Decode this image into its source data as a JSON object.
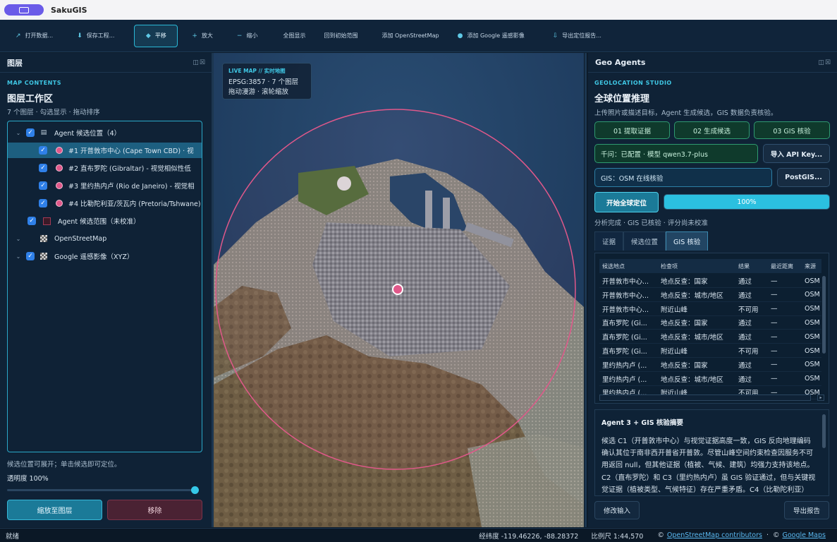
{
  "app": {
    "title": "SakuGIS"
  },
  "toolbar": {
    "items": [
      {
        "icon": "↗",
        "label": "打开数据..."
      },
      {
        "icon": "⬇",
        "label": "保存工程..."
      },
      {
        "icon": "◆",
        "label": "平移"
      },
      {
        "icon": "+",
        "label": "放大"
      },
      {
        "icon": "−",
        "label": "缩小"
      },
      {
        "icon": "",
        "label": "全图显示"
      },
      {
        "icon": "",
        "label": "回到初始范围"
      },
      {
        "icon": "",
        "label": "添加 OpenStreetMap"
      },
      {
        "icon": "●",
        "label": "添加 Google 遥感影像"
      },
      {
        "icon": "⇩",
        "label": "导出定位报告..."
      }
    ],
    "active_index": 2
  },
  "layers_panel": {
    "title": "图层",
    "kicker": "MAP CONTENTS",
    "heading": "图层工作区",
    "subtitle": "7 个图层 · 勾选显示 · 拖动排序",
    "rows": [
      {
        "label": "Agent 候选位置（4）"
      },
      {
        "label": "#1 开普敦市中心 (Cape Town CBD) · 视"
      },
      {
        "label": "#2 直布罗陀 (Gibraltar) - 视觉相似性低"
      },
      {
        "label": "#3 里约热内卢 (Rio de Janeiro) - 视觉相"
      },
      {
        "label": "#4 比勒陀利亚/茨瓦内 (Pretoria/Tshwane)"
      },
      {
        "label": "Agent 候选范围（未校准）"
      },
      {
        "label": "OpenStreetMap"
      },
      {
        "label": "Google 遥感影像（XYZ）"
      }
    ],
    "hint": "候选位置可展开；单击候选即可定位。",
    "opacity_label": "透明度 100%",
    "opacity_value": 1.0,
    "zoom_button": "缩放至图层",
    "remove_button": "移除"
  },
  "map": {
    "badge_kicker": "LIVE MAP // 实时地图",
    "badge_line1": "EPSG:3857 · 7 个图层",
    "badge_line2": "拖动漫游 · 滚轮缩放"
  },
  "agents_panel": {
    "title": "Geo Agents",
    "kicker": "GEOLOCATION STUDIO",
    "heading": "全球位置推理",
    "subtitle": "上传照片或描述目标，Agent 生成候选，GIS 数据负责核验。",
    "steps": [
      "01 提取证据",
      "02 生成候选",
      "03 GIS 核验"
    ],
    "model_status": "千问：已配置 · 模型 qwen3.7-plus",
    "import_api": "导入 API Key...",
    "gis_status": "GIS：OSM 在线核验",
    "postgis": "PostGIS...",
    "start_button": "开始全球定位",
    "progress_text": "100%",
    "progress_value": 1.0,
    "analysis_status": "分析完成 · GIS 已核验 · 评分尚未校准",
    "tabs": [
      "证据",
      "候选位置",
      "GIS 核验"
    ],
    "active_tab": 2,
    "table": {
      "headers": [
        "候选地点",
        "检查项",
        "结果",
        "最近距离",
        "来源"
      ],
      "rows": [
        [
          "开普敦市中心...",
          "地点反查：国家",
          "通过",
          "—",
          "OSM"
        ],
        [
          "开普敦市中心...",
          "地点反查：城市/地区",
          "通过",
          "—",
          "OSM"
        ],
        [
          "开普敦市中心...",
          "附近山峰",
          "不可用",
          "—",
          "OSM"
        ],
        [
          "直布罗陀 (Gi...",
          "地点反查：国家",
          "通过",
          "—",
          "OSM"
        ],
        [
          "直布罗陀 (Gi...",
          "地点反查：城市/地区",
          "通过",
          "—",
          "OSM"
        ],
        [
          "直布罗陀 (Gi...",
          "附近山峰",
          "不可用",
          "—",
          "OSM"
        ],
        [
          "里约热内卢 (...",
          "地点反查：国家",
          "通过",
          "—",
          "OSM"
        ],
        [
          "里约热内卢 (...",
          "地点反查：城市/地区",
          "通过",
          "—",
          "OSM"
        ],
        [
          "里约热内卢 (...",
          "附近山峰",
          "不可用",
          "—",
          "OSM"
        ]
      ]
    },
    "summary_title": "Agent 3 + GIS 核验摘要",
    "summary_body": "候选 C1（开普敦市中心）与视觉证据高度一致，GIS 反向地理编码确认其位于南非西开普省开普敦。尽管山峰空间约束检查因服务不可用返回 null，但其他证据（植被、气候、建筑）均强力支持该地点。C2（直布罗陀）和 C3（里约热内卢）虽 GIS 验证通过，但与关键视觉证据（植被类型、气候特征）存在严重矛盾。C4（比勒陀利亚）",
    "edit_button": "修改输入",
    "export_button": "导出报告"
  },
  "status": {
    "ready": "就绪",
    "coords": "经纬度 -119.46226, -88.28372",
    "scale": "比例尺 1:44,570",
    "attr_osm": "OpenStreetMap contributors",
    "attr_google": "Google Maps",
    "copyright": "©",
    "sep": "·"
  },
  "colors": {
    "accent": "#2bc0e0",
    "candidate": "#e0588a",
    "panel": "#0f2236"
  }
}
